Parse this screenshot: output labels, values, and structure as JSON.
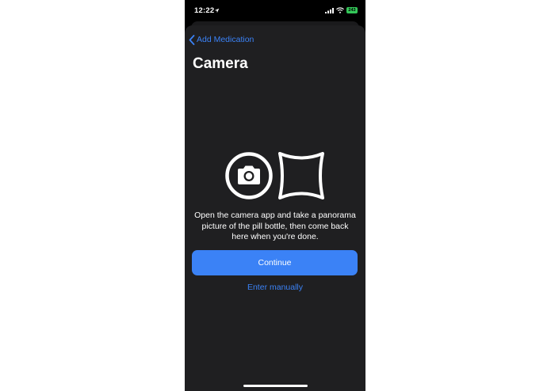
{
  "status_bar": {
    "time": "12:22",
    "battery": "243",
    "icons": [
      "location-icon",
      "signal-icon",
      "wifi-icon",
      "battery-icon"
    ]
  },
  "nav": {
    "back_label": "Add Medication",
    "back_icon": "chevron-left-icon"
  },
  "page": {
    "title": "Camera",
    "illustration_icons": [
      "camera-icon",
      "panorama-icon"
    ],
    "description": "Open the camera app and take a panorama picture of the pill bottle, then come back here when you're done."
  },
  "actions": {
    "continue_label": "Continue",
    "manual_label": "Enter manually"
  },
  "colors": {
    "accent": "#3b82f6",
    "sheet_background": "#1f1f21",
    "status_background": "#000000",
    "battery": "#34c759"
  }
}
